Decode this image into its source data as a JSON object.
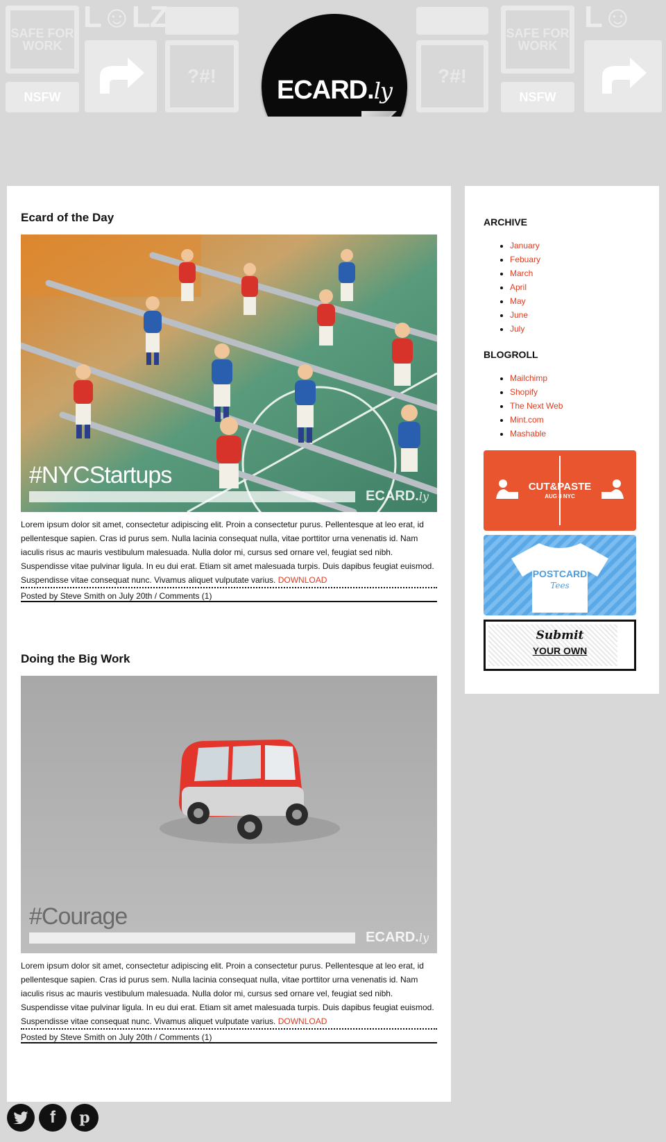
{
  "header": {
    "logo_main": "ECARD.",
    "logo_suffix": "ly",
    "pattern": {
      "safe_tile": "SAFE FOR WORK",
      "nsfw_tile": "NSFW",
      "lolz_tile": "L☺LZ",
      "symbols_tile": "?#!"
    }
  },
  "posts": [
    {
      "title": "Ecard of the Day",
      "image_tag": "#NYCStartups",
      "image_watermark": "ECARD.",
      "image_watermark_suffix": "ly",
      "body": "Lorem ipsum dolor sit amet, consectetur adipiscing elit. Proin a consectetur purus. Pellentesque at leo erat, id pellentesque sapien. Cras id purus sem. Nulla lacinia consequat nulla, vitae porttitor urna venenatis id. Nam iaculis risus ac mauris vestibulum malesuada. Nulla dolor mi, cursus sed ornare vel, feugiat sed nibh. Suspendisse vitae pulvinar ligula. In eu dui erat. Etiam sit amet malesuada turpis. Duis dapibus feugiat euismod. Suspendisse vitae consequat nunc. Vivamus aliquet vulputate varius.",
      "download_label": "DOWNLOAD",
      "meta": "Posted by Steve Smith on July 20th / Comments (1)"
    },
    {
      "title": "Doing the Big Work",
      "image_tag": "#Courage",
      "image_watermark": "ECARD.",
      "image_watermark_suffix": "ly",
      "body": "Lorem ipsum dolor sit amet, consectetur adipiscing elit. Proin a consectetur purus. Pellentesque at leo erat, id pellentesque sapien. Cras id purus sem. Nulla lacinia consequat nulla, vitae porttitor urna venenatis id. Nam iaculis risus ac mauris vestibulum malesuada. Nulla dolor mi, cursus sed ornare vel, feugiat sed nibh. Suspendisse vitae pulvinar ligula. In eu dui erat. Etiam sit amet malesuada turpis. Duis dapibus feugiat euismod. Suspendisse vitae consequat nunc. Vivamus aliquet vulputate varius.",
      "download_label": "DOWNLOAD",
      "meta": "Posted by Steve Smith on July 20th / Comments (1)"
    }
  ],
  "sidebar": {
    "archive_heading": "ARCHIVE",
    "archive": [
      "January",
      "Febuary",
      "March",
      "April",
      "May",
      "June",
      "July"
    ],
    "blogroll_heading": "BLOGROLL",
    "blogroll": [
      "Mailchimp",
      "Shopify",
      "The Next Web",
      "Mint.com",
      "Mashable"
    ],
    "banners": {
      "cutpaste_title": "CUT&PASTE",
      "cutpaste_sub": "AUG 8 NYC",
      "postcard_title": "POSTCARD",
      "postcard_sub": "Tees",
      "submit_line1": "Submit",
      "submit_line2": "YOUR OWN"
    }
  },
  "social": {
    "twitter": "t",
    "facebook": "f",
    "pinterest": "p"
  },
  "colors": {
    "accent": "#e03a1e",
    "background": "#d8d8d8",
    "cutpaste_banner": "#e8552f",
    "postcard_banner": "#5aa9e6"
  }
}
